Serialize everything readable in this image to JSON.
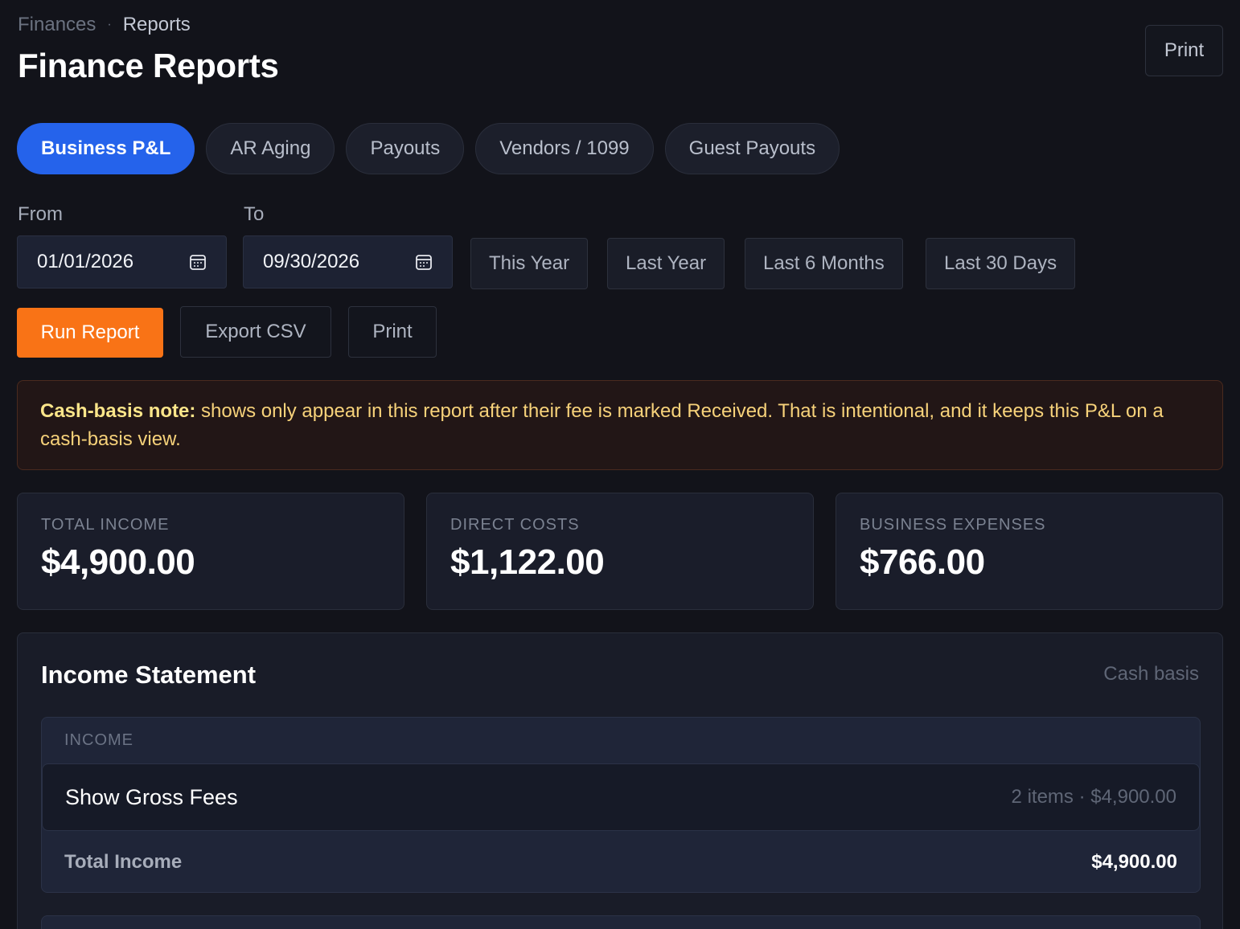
{
  "breadcrumb": {
    "root": "Finances",
    "separator": "·",
    "current": "Reports"
  },
  "page": {
    "title": "Finance Reports",
    "print_label": "Print"
  },
  "tabs": [
    {
      "label": "Business P&L",
      "active": true
    },
    {
      "label": "AR Aging",
      "active": false
    },
    {
      "label": "Payouts",
      "active": false
    },
    {
      "label": "Vendors / 1099",
      "active": false
    },
    {
      "label": "Guest Payouts",
      "active": false
    }
  ],
  "filters": {
    "from_label": "From",
    "from_value": "01/01/2026",
    "to_label": "To",
    "to_value": "09/30/2026",
    "presets": [
      "This Year",
      "Last Year",
      "Last 6 Months",
      "Last 30 Days"
    ]
  },
  "actions": {
    "run": "Run Report",
    "export": "Export CSV",
    "print": "Print"
  },
  "note": {
    "strong": "Cash-basis note:",
    "text": " shows only appear in this report after their fee is marked Received. That is intentional, and it keeps this P&L on a cash-basis view."
  },
  "stats": [
    {
      "label": "TOTAL INCOME",
      "value": "$4,900.00"
    },
    {
      "label": "DIRECT COSTS",
      "value": "$1,122.00"
    },
    {
      "label": "BUSINESS EXPENSES",
      "value": "$766.00"
    }
  ],
  "statement": {
    "title": "Income Statement",
    "basis": "Cash basis",
    "income": {
      "heading": "INCOME",
      "row": {
        "label": "Show Gross Fees",
        "meta": "2 items · $4,900.00"
      },
      "total_label": "Total Income",
      "total_value": "$4,900.00"
    }
  },
  "colors": {
    "accent": "#2563eb",
    "run_button": "#f97316",
    "note_text": "#f7d27a",
    "background": "#12131a"
  }
}
